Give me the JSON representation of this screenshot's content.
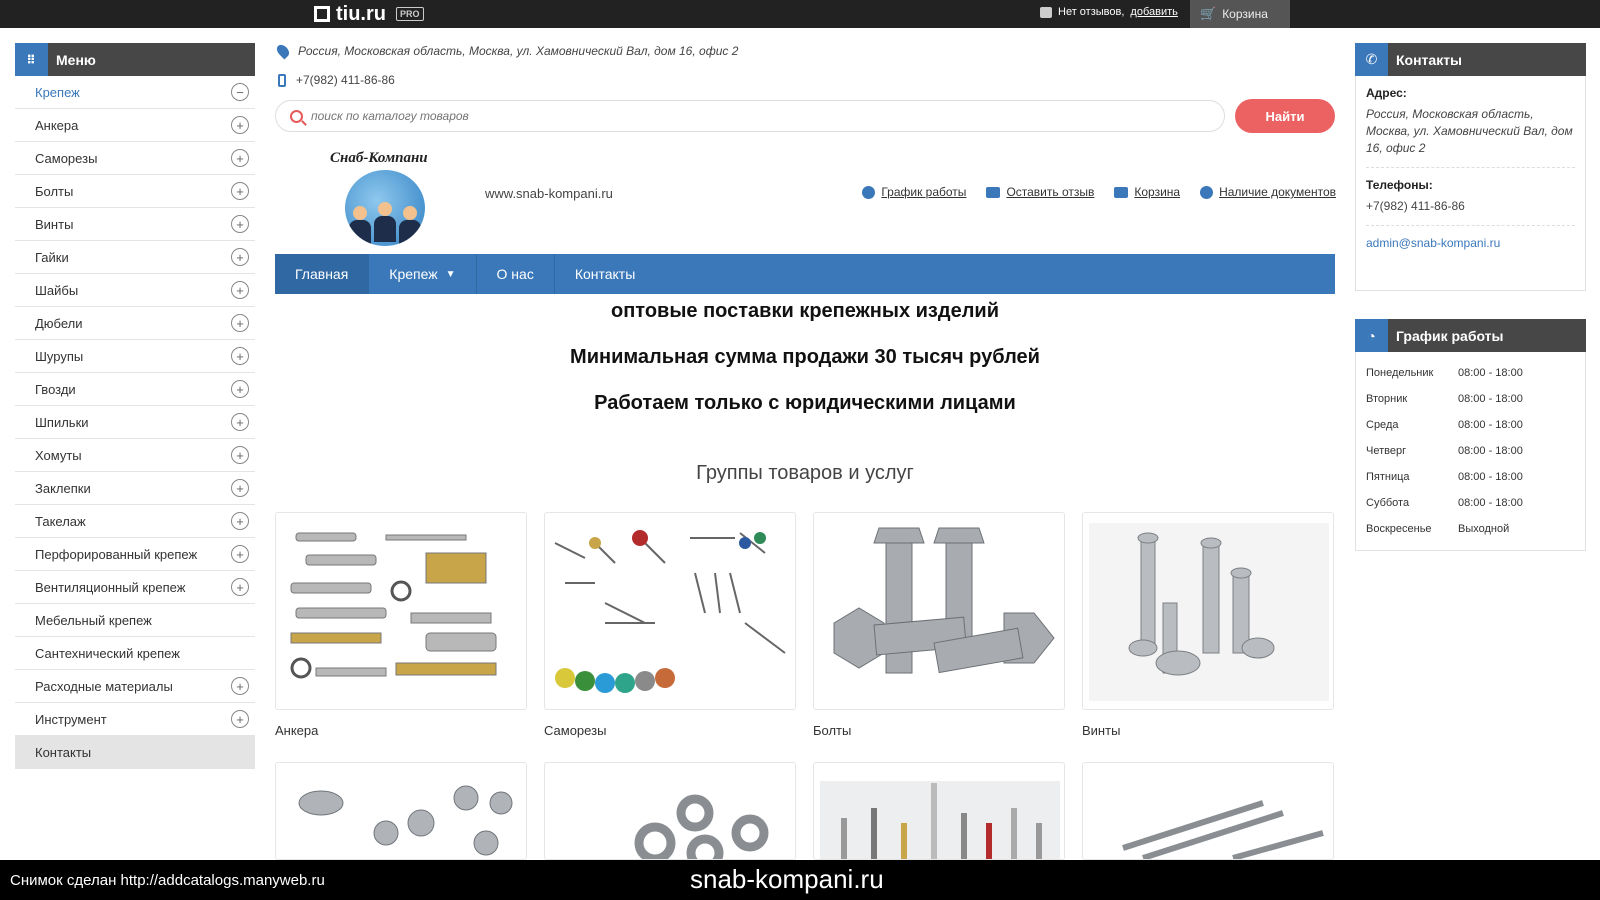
{
  "topbar": {
    "logo_text": "tiu.ru",
    "logo_badge": "PRO",
    "reviews_text": "Нет отзывов,",
    "reviews_link": "добавить",
    "cart_label": "Корзина"
  },
  "sidebar": {
    "title": "Меню",
    "items": [
      {
        "label": "Крепеж",
        "toggle": "−"
      },
      {
        "label": "Анкера",
        "toggle": "+"
      },
      {
        "label": "Саморезы",
        "toggle": "+"
      },
      {
        "label": "Болты",
        "toggle": "+"
      },
      {
        "label": "Винты",
        "toggle": "+"
      },
      {
        "label": "Гайки",
        "toggle": "+"
      },
      {
        "label": "Шайбы",
        "toggle": "+"
      },
      {
        "label": "Дюбели",
        "toggle": "+"
      },
      {
        "label": "Шурупы",
        "toggle": "+"
      },
      {
        "label": "Гвозди",
        "toggle": "+"
      },
      {
        "label": "Шпильки",
        "toggle": "+"
      },
      {
        "label": "Хомуты",
        "toggle": "+"
      },
      {
        "label": "Заклепки",
        "toggle": "+"
      },
      {
        "label": "Такелаж",
        "toggle": "+"
      },
      {
        "label": "Перфорированный крепеж",
        "toggle": "+"
      },
      {
        "label": "Вентиляционный крепеж",
        "toggle": "+"
      },
      {
        "label": "Мебельный крепеж",
        "toggle": ""
      },
      {
        "label": "Сантехнический крепеж",
        "toggle": ""
      },
      {
        "label": "Расходные материалы",
        "toggle": "+"
      },
      {
        "label": "Инструмент",
        "toggle": "+"
      },
      {
        "label": "Контакты",
        "toggle": ""
      }
    ]
  },
  "header": {
    "address": "Россия, Московская область, Москва, ул. Хамовнический Вал, дом 16, офис 2",
    "phone": "+7(982) 411-86-86",
    "search_placeholder": "поиск по каталогу товаров",
    "search_button": "Найти",
    "brand_name": "Снаб-Компани",
    "site_url": "www.snab-kompani.ru",
    "links": [
      "График работы",
      "Оставить отзыв",
      "Корзина",
      "Наличие документов"
    ]
  },
  "nav": {
    "items": [
      "Главная",
      "Крепеж",
      "О нас",
      "Контакты"
    ]
  },
  "main": {
    "headline_1": "оптовые поставки крепежных изделий",
    "headline_2": "Минимальная сумма продажи 30 тысяч рублей",
    "headline_3": "Работаем только с юридическими лицами",
    "groups_title": "Группы товаров и услуг",
    "cards": [
      "Анкера",
      "Саморезы",
      "Болты",
      "Винты"
    ]
  },
  "contacts": {
    "title": "Контакты",
    "address_label": "Адрес:",
    "address": "Россия, Московская область, Москва, ул. Хамовнический Вал, дом 16, офис 2",
    "phones_label": "Телефоны:",
    "phone": "+7(982) 411-86-86",
    "email": "admin@snab-kompani.ru"
  },
  "schedule": {
    "title": "График работы",
    "rows": [
      {
        "day": "Понедельник",
        "time": "08:00 - 18:00"
      },
      {
        "day": "Вторник",
        "time": "08:00 - 18:00"
      },
      {
        "day": "Среда",
        "time": "08:00 - 18:00"
      },
      {
        "day": "Четверг",
        "time": "08:00 - 18:00"
      },
      {
        "day": "Пятница",
        "time": "08:00 - 18:00"
      },
      {
        "day": "Суббота",
        "time": "08:00 - 18:00"
      },
      {
        "day": "Воскресенье",
        "time": "Выходной"
      }
    ]
  },
  "overlay": {
    "note": "Снимок сделан http://addcatalogs.manyweb.ru",
    "site": "snab-kompani.ru"
  },
  "colors": {
    "accent": "#3b78ba",
    "button": "#ec6262",
    "header_dark": "#474747"
  }
}
